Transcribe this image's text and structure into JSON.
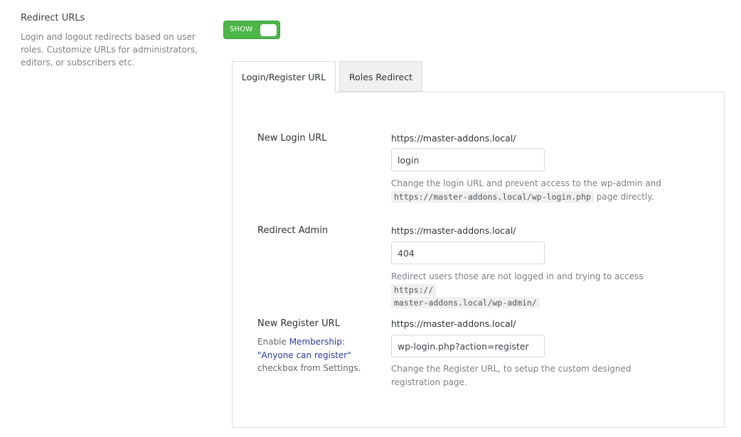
{
  "section": {
    "title": "Redirect URLs",
    "description": "Login and logout redirects based on user roles. Customize URLs for administrators, editors, or subscribers etc."
  },
  "toggle": {
    "label": "SHOW",
    "state": "on",
    "color": "#4cb648"
  },
  "tabs": [
    {
      "label": "Login/Register URL",
      "active": true
    },
    {
      "label": "Roles Redirect",
      "active": false
    }
  ],
  "fields": {
    "login": {
      "label": "New Login URL",
      "prefix": "https://master-addons.local/",
      "value": "login",
      "help_text": "Change the login URL and prevent access to the wp-admin and",
      "help_code": "https://master-addons.local/wp-login.php",
      "help_suffix": "page directly."
    },
    "admin": {
      "label": "Redirect Admin",
      "prefix": "https://master-addons.local/",
      "value": "404",
      "help_text": "Redirect users those are not logged in and trying to access",
      "help_code_line1": "https://",
      "help_code_line2": "master-addons.local/wp-admin/"
    },
    "register": {
      "label": "New Register URL",
      "sub_prefix": "Enable",
      "sub_link": "Membership: \"Anyone can register\"",
      "sub_suffix": "checkbox from Settings.",
      "prefix": "https://master-addons.local/",
      "value": "wp-login.php?action=register",
      "help_text": "Change the Register URL, to setup the custom designed registration page."
    }
  }
}
